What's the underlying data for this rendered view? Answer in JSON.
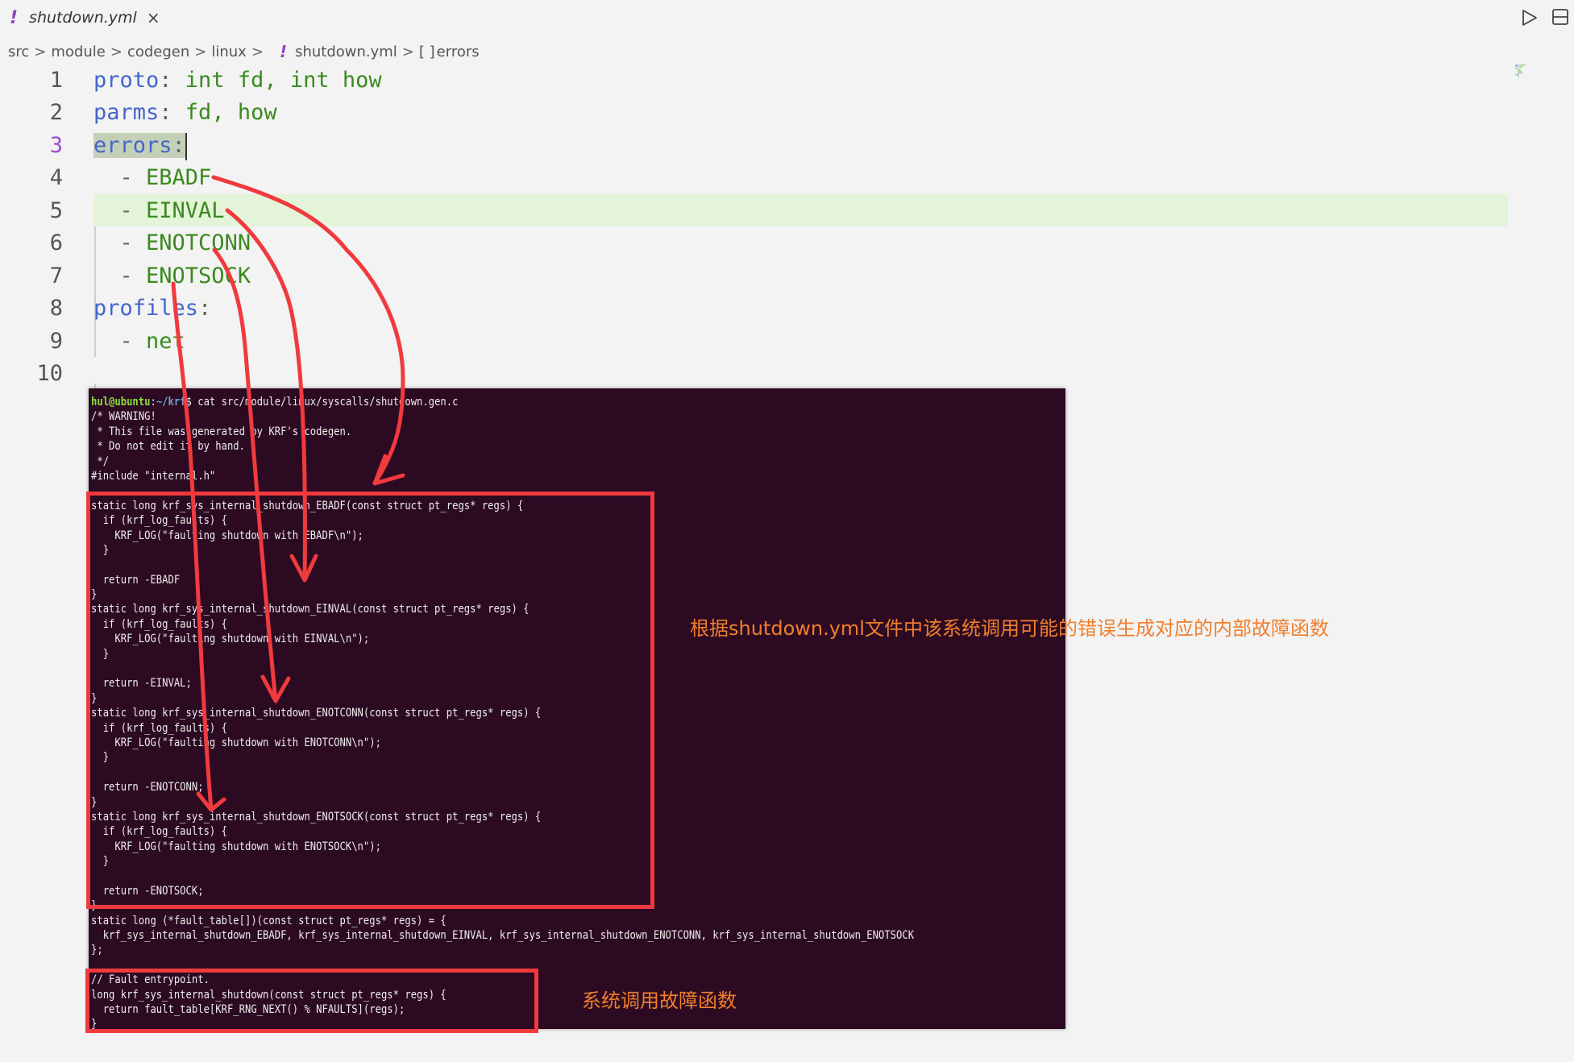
{
  "tab": {
    "icon": "!",
    "title": "shutdown.yml",
    "close": "×"
  },
  "toolbar": {
    "run_icon": "play-icon",
    "split_icon": "split-editor-icon"
  },
  "breadcrumb": {
    "items": [
      "src",
      "module",
      "codegen",
      "linux"
    ],
    "file_icon": "!",
    "file": "shutdown.yml",
    "symbol_icon": "[ ]",
    "symbol": "errors",
    "separator": ">"
  },
  "editor": {
    "active_line": 3,
    "lines": [
      {
        "n": "1",
        "key": "proto",
        "colon": ":",
        "value": " int fd, int how"
      },
      {
        "n": "2",
        "key": "parms",
        "colon": ":",
        "value": " fd, how"
      },
      {
        "n": "3",
        "key": "errors",
        "colon": ":",
        "value": ""
      },
      {
        "n": "4",
        "dash": "  - ",
        "value": "EBADF"
      },
      {
        "n": "5",
        "dash": "  - ",
        "value": "EINVAL"
      },
      {
        "n": "6",
        "dash": "  - ",
        "value": "ENOTCONN"
      },
      {
        "n": "7",
        "dash": "  - ",
        "value": "ENOTSOCK"
      },
      {
        "n": "8",
        "key": "profiles",
        "colon": ":",
        "value": ""
      },
      {
        "n": "9",
        "dash": "  - ",
        "value": "net"
      },
      {
        "n": "10",
        "value": ""
      }
    ]
  },
  "terminal": {
    "prompt_user": "hul@ubuntu",
    "prompt_colon": ":",
    "prompt_path": "~/krf",
    "prompt_command": "$ cat src/module/linux/syscalls/shutdown.gen.c",
    "lines": [
      "/* WARNING!",
      " * This file was generated by KRF's codegen.",
      " * Do not edit it by hand.",
      " */",
      "#include \"internal.h\"",
      "",
      "static long krf_sys_internal_shutdown_EBADF(const struct pt_regs* regs) {",
      "  if (krf_log_faults) {",
      "    KRF_LOG(\"faulting shutdown with EBADF\\n\");",
      "  }",
      "",
      "  return -EBADF",
      "}",
      "static long krf_sys_internal_shutdown_EINVAL(const struct pt_regs* regs) {",
      "  if (krf_log_faults) {",
      "    KRF_LOG(\"faulting shutdown with EINVAL\\n\");",
      "  }",
      "",
      "  return -EINVAL;",
      "}",
      "static long krf_sys_internal_shutdown_ENOTCONN(const struct pt_regs* regs) {",
      "  if (krf_log_faults) {",
      "    KRF_LOG(\"faulting shutdown with ENOTCONN\\n\");",
      "  }",
      "",
      "  return -ENOTCONN;",
      "}",
      "static long krf_sys_internal_shutdown_ENOTSOCK(const struct pt_regs* regs) {",
      "  if (krf_log_faults) {",
      "    KRF_LOG(\"faulting shutdown with ENOTSOCK\\n\");",
      "  }",
      "",
      "  return -ENOTSOCK;",
      "}",
      "static long (*fault_table[])(const struct pt_regs* regs) = {",
      "  krf_sys_internal_shutdown_EBADF, krf_sys_internal_shutdown_EINVAL, krf_sys_internal_shutdown_ENOTCONN, krf_sys_internal_shutdown_ENOTSOCK",
      "};",
      "",
      "// Fault entrypoint.",
      "long krf_sys_internal_shutdown(const struct pt_regs* regs) {",
      "  return fault_table[KRF_RNG_NEXT() % NFAULTS](regs);",
      "}"
    ]
  },
  "annotations": {
    "functions_note": "根据shutdown.yml文件中该系统调用可能的错误生成对应的内部故障函数",
    "entry_note": "系统调用故障函数",
    "color": "#f07f2c",
    "box_color": "#f03a3e"
  }
}
